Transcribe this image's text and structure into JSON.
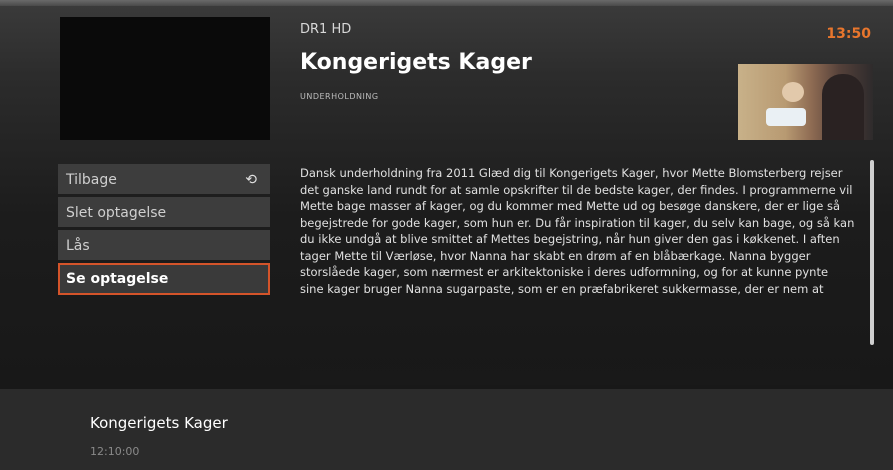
{
  "header": {
    "channel": "DR1 HD",
    "clock": "13:50"
  },
  "program": {
    "title": "Kongerigets Kager",
    "genre": "UNDERHOLDNING",
    "description": "Dansk underholdning fra 2011 Glæd dig til Kongerigets Kager, hvor Mette Blomsterberg rejser det ganske land rundt for at samle opskrifter til de bedste kager, der findes. I programmerne vil Mette bage masser af kager, og du kommer med Mette ud og besøge danskere, der er lige så begejstrede for gode kager, som hun er. Du får inspiration til kager, du selv kan bage, og så kan du ikke undgå at blive smittet af Mettes begejstring, når hun giver den gas i køkkenet. I aften tager Mette til Værløse, hvor Nanna har skabt en drøm af en blåbærkage. Nanna bygger storslåede kager, som nærmest er arkitektoniske i deres udformning, og for at kunne pynte sine kager bruger Nanna sugarpaste, som er en præfabrikeret sukkermasse, der er nem at"
  },
  "menu": {
    "items": [
      {
        "label": "Tilbage",
        "icon": "back-arrow-icon"
      },
      {
        "label": "Slet optagelse"
      },
      {
        "label": "Lås"
      },
      {
        "label": "Se optagelse",
        "selected": true
      }
    ]
  },
  "footer": {
    "title": "Kongerigets Kager",
    "time": "12:10:00"
  },
  "colors": {
    "accent": "#d4542a",
    "clock": "#e8762d"
  }
}
